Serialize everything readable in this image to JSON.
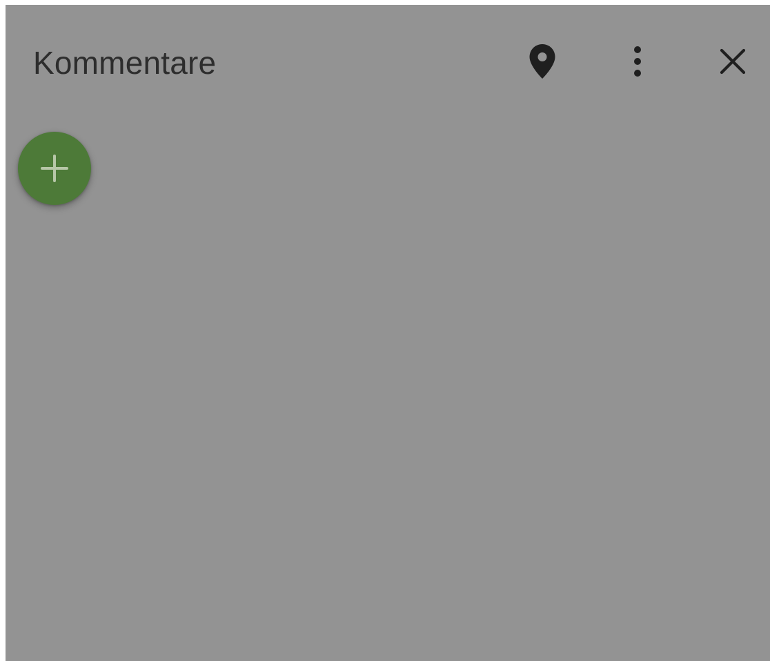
{
  "panel": {
    "title": "Kommentare",
    "background_color": "#939393"
  },
  "header_actions": [
    {
      "icon": "map-pin-icon"
    },
    {
      "icon": "more-vertical-icon"
    },
    {
      "icon": "close-icon"
    }
  ],
  "fab": {
    "icon": "plus-icon",
    "color": "#4d7a38"
  }
}
